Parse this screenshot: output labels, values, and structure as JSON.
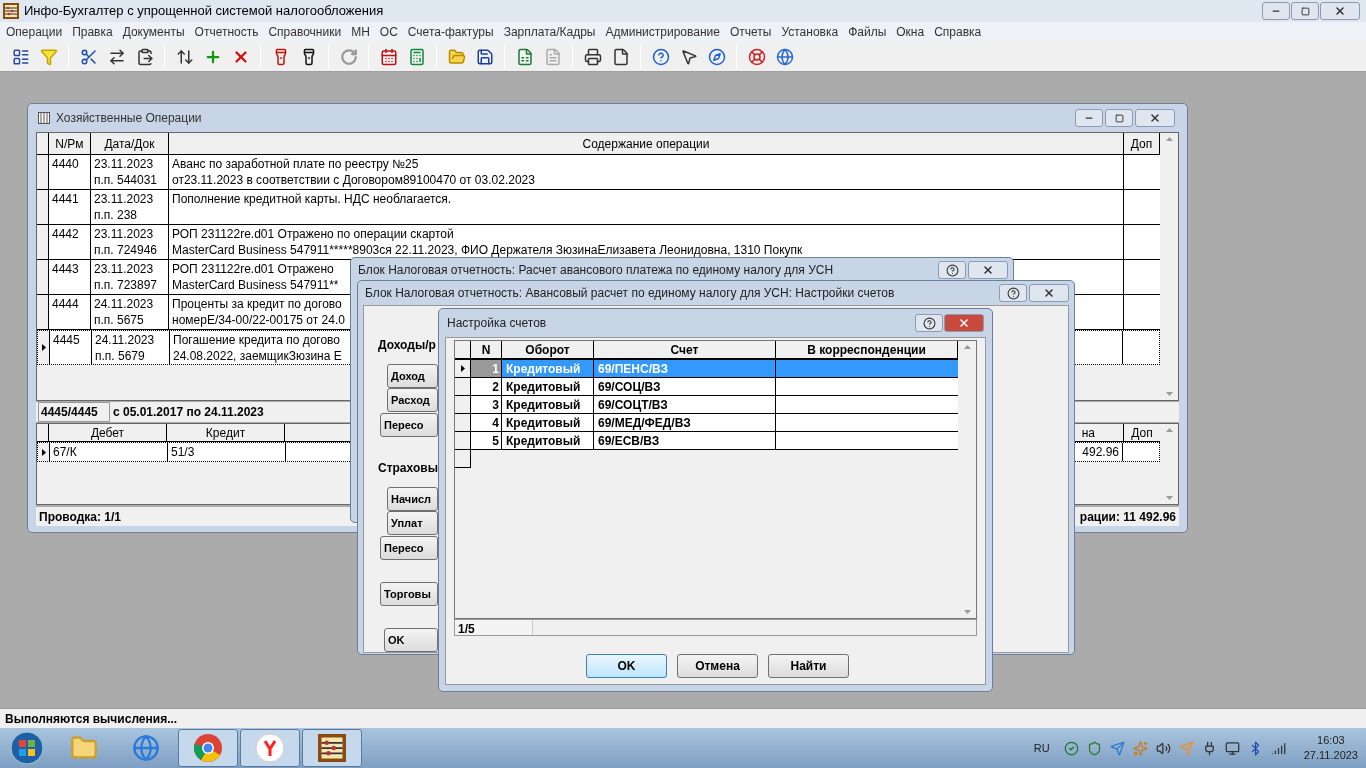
{
  "app": {
    "title": "Инфо-Бухгалтер с упрощенной системой налогообложения"
  },
  "menu": [
    "Операции",
    "Правка",
    "Документы",
    "Отчетность",
    "Справочники",
    "МН",
    "ОС",
    "Счета-фактуры",
    "Зарплата/Кадры",
    "Администрирование",
    "Отчеты",
    "Установка",
    "Файлы",
    "Окна",
    "Справка"
  ],
  "operations_window": {
    "title": "Хозяйственные Операции",
    "columns": [
      "N/Рм",
      "Дата/Док",
      "Содержание операции",
      "Доп"
    ],
    "rows": [
      {
        "number": "4440",
        "date": "23.11.2023",
        "doc": "п.п. 544031",
        "lines": [
          "Аванс по заработной плате по реестру №25",
          "от23.11.2023 в соответствии с Договором89100470 от 03.02.2023"
        ],
        "selected": false
      },
      {
        "number": "4441",
        "date": "23.11.2023",
        "doc": "п.п. 238",
        "lines": [
          "Пополнение кредитной карты. НДС необлагается."
        ],
        "selected": false
      },
      {
        "number": "4442",
        "date": "23.11.2023",
        "doc": "п.п. 724946",
        "lines": [
          "РОП 231122re.d01 Отражено по операции скартой",
          "MasterCard Business 547911*****8903ся 22.11.2023, ФИО Держателя ЗюзинаЕлизавета Леонидовна, 1310 Покупк"
        ],
        "selected": false
      },
      {
        "number": "4443",
        "date": "23.11.2023",
        "doc": "п.п. 723897",
        "lines": [
          "РОП 231122re.d01 Отражено",
          "MasterCard Business 547911**"
        ],
        "selected": false
      },
      {
        "number": "4444",
        "date": "24.11.2023",
        "doc": "п.п. 5675",
        "lines": [
          "Проценты за кредит по догово",
          "номерЕ/34-00/22-00175 от 24.0"
        ],
        "selected": false
      },
      {
        "number": "4445",
        "date": "24.11.2023",
        "doc": "п.п. 5679",
        "lines": [
          "Погашение кредита по догово",
          "24.08.2022, заемщикЗюзина Е"
        ],
        "selected": true
      }
    ],
    "record_counter": "4445/4445",
    "period": "с 05.01.2017 по 24.11.2023",
    "entries": {
      "columns": [
        "Дебет",
        "Кредит",
        "на",
        "Доп"
      ],
      "rows": [
        {
          "debit": "67/К",
          "credit": "51/3",
          "amount": "492.96",
          "selected": true
        }
      ]
    },
    "entries_counter": "Проводка: 1/1",
    "total": "рации: 11 492.96"
  },
  "payment_dialog": {
    "title": "Блок Налоговая отчетность: Расчет авансового платежа по единому налогу для УСН"
  },
  "settings_dialog": {
    "title": "Блок Налоговая отчетность: Авансовый расчет по единому налогу для УСН: Настройки счетов",
    "groups": [
      {
        "label": "Доходы/р",
        "buttons": [
          "Доход",
          "Расход",
          "Пересо"
        ]
      },
      {
        "label": "Страховы",
        "buttons": [
          "Начисл",
          "Уплат",
          "Пересо"
        ]
      },
      {
        "buttons": [
          "Торговы"
        ]
      }
    ],
    "ok": "OK"
  },
  "accounts_dialog": {
    "title": "Настройка счетов",
    "columns": [
      "N",
      "Оборот",
      "Счет",
      "В корреспонденции"
    ],
    "rows": [
      {
        "n": "1",
        "turnover": "Кредитовый",
        "account": "69/ПЕНС/ВЗ",
        "selected": true
      },
      {
        "n": "2",
        "turnover": "Кредитовый",
        "account": "69/СОЦ/ВЗ",
        "selected": false
      },
      {
        "n": "3",
        "turnover": "Кредитовый",
        "account": "69/СОЦТ/ВЗ",
        "selected": false
      },
      {
        "n": "4",
        "turnover": "Кредитовый",
        "account": "69/МЕД/ФЕД/ВЗ",
        "selected": false
      },
      {
        "n": "5",
        "turnover": "Кредитовый",
        "account": "69/ЕСВ/ВЗ",
        "selected": false
      }
    ],
    "counter": "1/5",
    "buttons": [
      "OK",
      "Отмена",
      "Найти"
    ]
  },
  "status_bar": "Выполняются вычисления...",
  "taskbar": {
    "language": "RU",
    "time": "16:03",
    "date": "27.11.2023"
  }
}
